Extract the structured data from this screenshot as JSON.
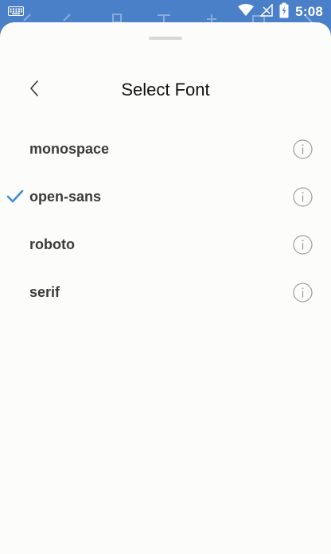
{
  "status_bar": {
    "time": "5:08",
    "icons": [
      "keyboard-icon",
      "wifi-icon",
      "signal-icon",
      "battery-icon"
    ]
  },
  "sheet": {
    "title": "Select Font",
    "back_icon": "chevron-left-icon",
    "fonts": [
      {
        "label": "monospace",
        "selected": false
      },
      {
        "label": "open-sans",
        "selected": true
      },
      {
        "label": "roboto",
        "selected": false
      },
      {
        "label": "serif",
        "selected": false
      }
    ]
  },
  "colors": {
    "status_bar_bg": "#4a80c8",
    "sheet_bg": "#fcfcfb",
    "check_accent": "#3a8fd8",
    "label_text": "#3b3b3b",
    "info_icon": "#9e9e9e"
  }
}
